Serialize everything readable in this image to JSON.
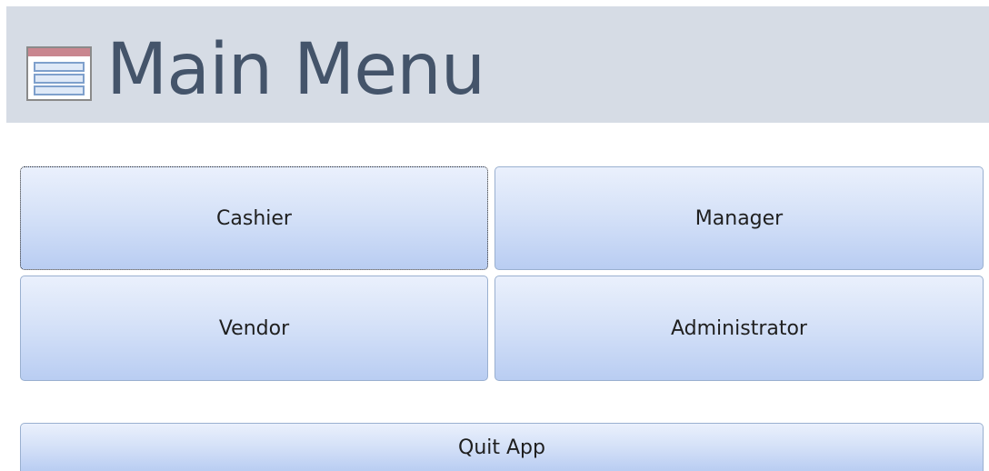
{
  "header": {
    "title": "Main Menu",
    "icon": "form-icon"
  },
  "buttons": {
    "cashier": "Cashier",
    "manager": "Manager",
    "vendor": "Vendor",
    "administrator": "Administrator",
    "quit": "Quit App"
  },
  "colors": {
    "header_background": "#d6dce5",
    "title_text": "#44546a",
    "button_gradient_top": "#eaf0fc",
    "button_gradient_bottom": "#b9cdf2",
    "button_border": "#9ab0d0"
  }
}
